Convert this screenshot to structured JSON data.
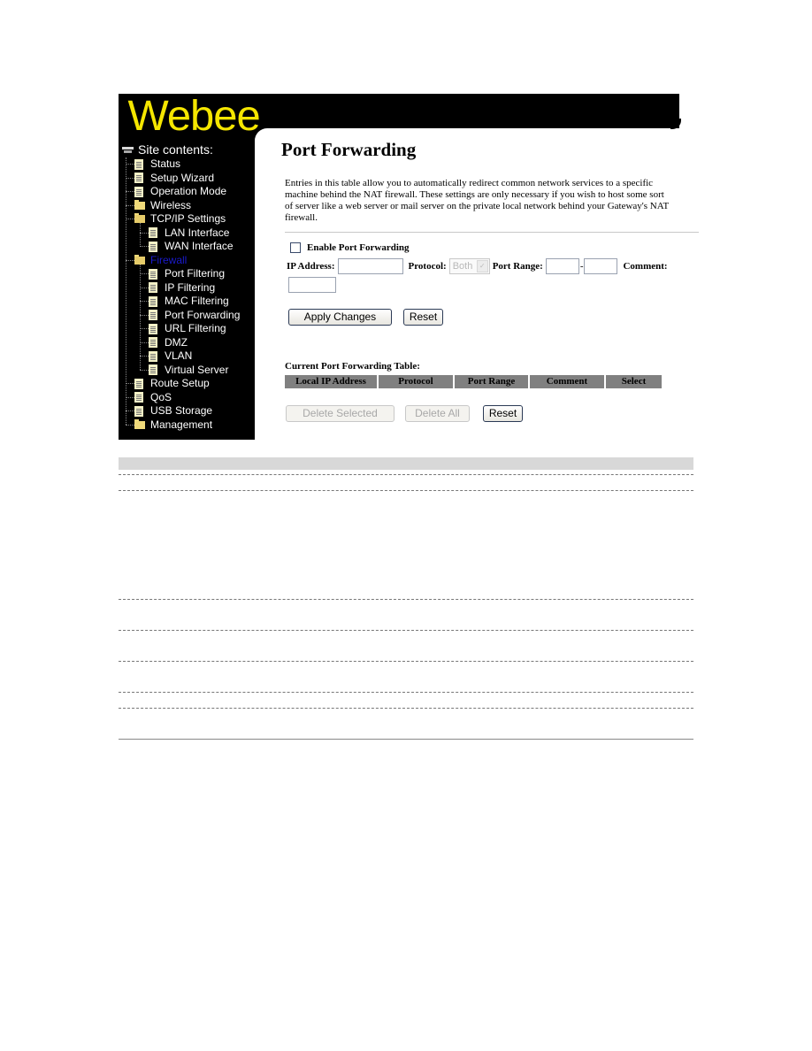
{
  "brand": {
    "logo": "Webee",
    "logo_color": "#f5e600"
  },
  "sidebar": {
    "title": "Site contents:",
    "items": [
      {
        "label": "Status",
        "icon": "document-icon",
        "level": 1
      },
      {
        "label": "Setup Wizard",
        "icon": "document-icon",
        "level": 1
      },
      {
        "label": "Operation Mode",
        "icon": "document-icon",
        "level": 1
      },
      {
        "label": "Wireless",
        "icon": "folder-icon",
        "level": 1
      },
      {
        "label": "TCP/IP Settings",
        "icon": "folder-open-icon",
        "level": 1
      },
      {
        "label": "LAN Interface",
        "icon": "document-icon",
        "level": 2
      },
      {
        "label": "WAN Interface",
        "icon": "document-icon",
        "level": 2
      },
      {
        "label": "Firewall",
        "icon": "folder-open-icon",
        "level": 1,
        "active": true
      },
      {
        "label": "Port Filtering",
        "icon": "document-icon",
        "level": 2
      },
      {
        "label": "IP Filtering",
        "icon": "document-icon",
        "level": 2
      },
      {
        "label": "MAC Filtering",
        "icon": "document-icon",
        "level": 2
      },
      {
        "label": "Port Forwarding",
        "icon": "document-icon",
        "level": 2
      },
      {
        "label": "URL Filtering",
        "icon": "document-icon",
        "level": 2
      },
      {
        "label": "DMZ",
        "icon": "document-icon",
        "level": 2
      },
      {
        "label": "VLAN",
        "icon": "document-icon",
        "level": 2
      },
      {
        "label": "Virtual Server",
        "icon": "document-icon",
        "level": 2
      },
      {
        "label": "Route Setup",
        "icon": "document-icon",
        "level": 1
      },
      {
        "label": "QoS",
        "icon": "document-icon",
        "level": 1
      },
      {
        "label": "USB Storage",
        "icon": "document-icon",
        "level": 1
      },
      {
        "label": "Management",
        "icon": "folder-icon",
        "level": 1
      }
    ]
  },
  "main": {
    "title": "Port Forwarding",
    "description": "Entries in this table allow you to automatically redirect common network services to a specific machine behind the NAT firewall. These settings are only necessary if you wish to host some sort of server like a web server or mail server on the private local network behind your Gateway's NAT firewall.",
    "enable_label": "Enable Port Forwarding",
    "enable_checked": false,
    "ip_label": "IP Address:",
    "ip_value": "",
    "protocol_label": "Protocol:",
    "protocol_value": "Both",
    "port_range_label": "Port Range:",
    "port_from": "",
    "port_sep": "-",
    "port_to": "",
    "comment_label": "Comment:",
    "comment_value": "",
    "apply_label": "Apply Changes",
    "reset_label": "Reset",
    "table_caption": "Current Port Forwarding Table:",
    "table_columns": [
      "Local IP Address",
      "Protocol",
      "Port Range",
      "Comment",
      "Select"
    ],
    "delete_selected_label": "Delete Selected",
    "delete_all_label": "Delete All",
    "reset2_label": "Reset"
  }
}
